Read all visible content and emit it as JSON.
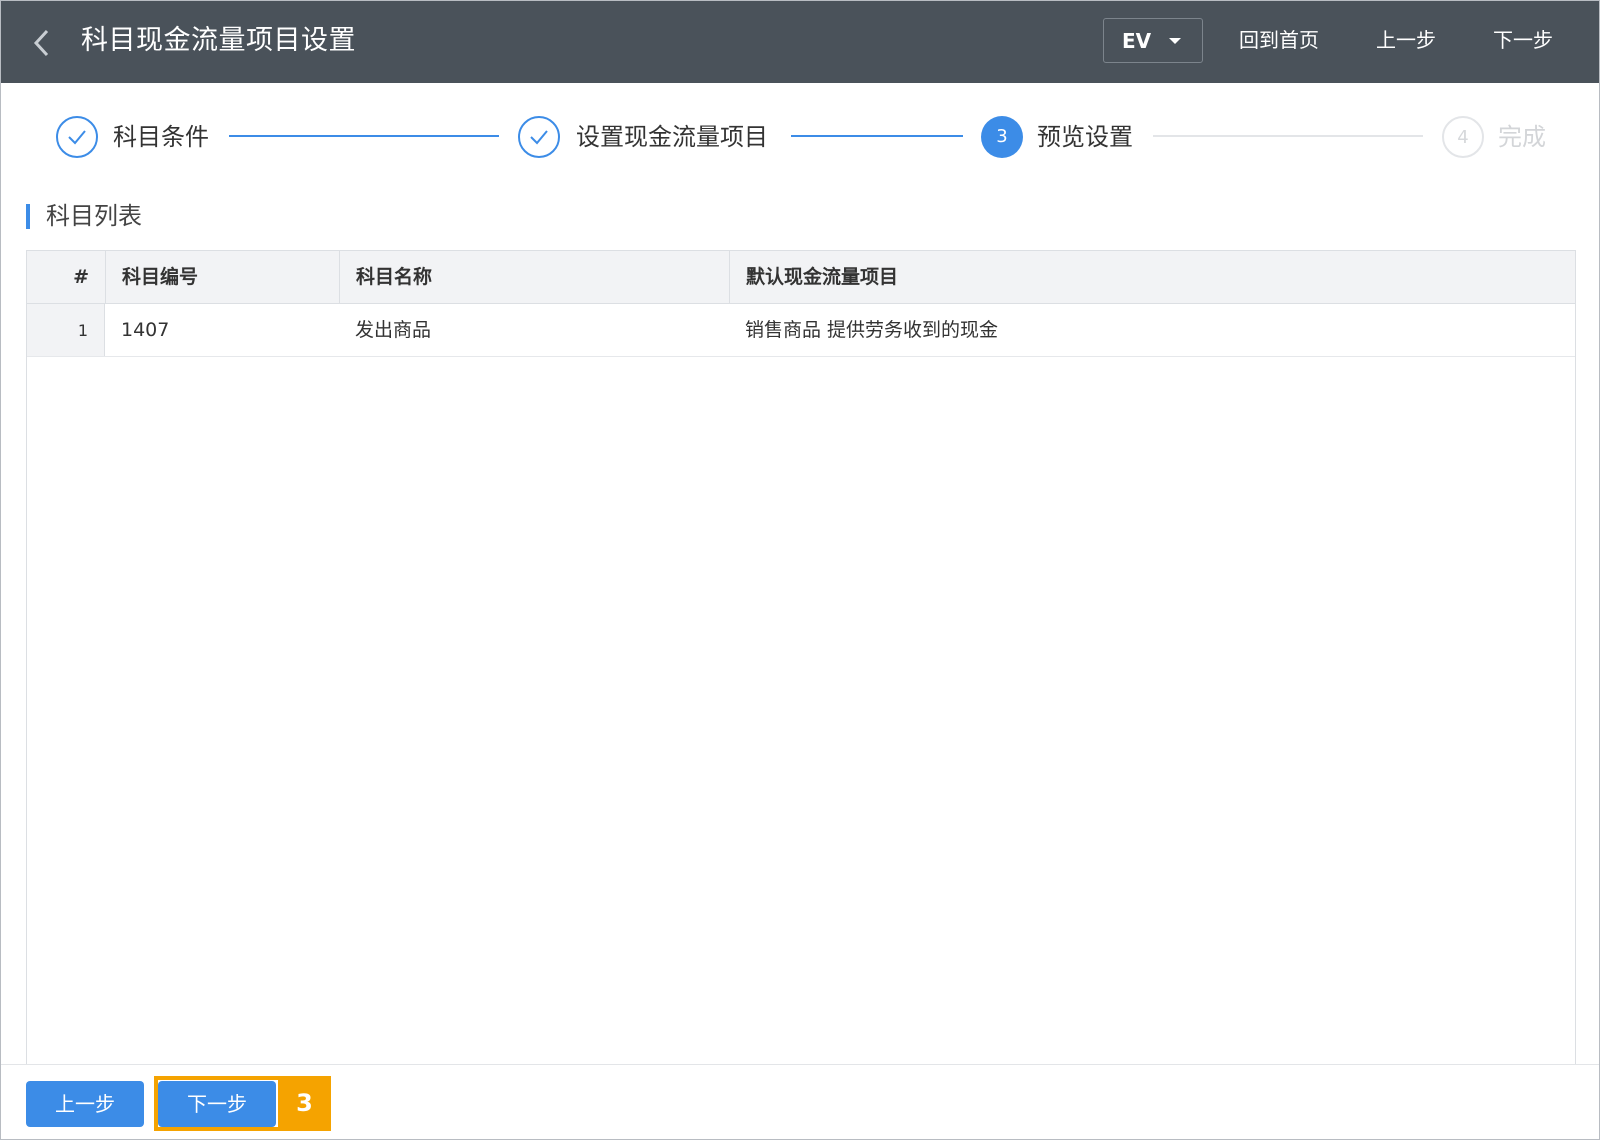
{
  "header": {
    "title": "科目现金流量项目设置",
    "language": "EV",
    "links": [
      "回到首页",
      "上一步",
      "下一步"
    ]
  },
  "steps": [
    {
      "label": "科目条件",
      "status": "done"
    },
    {
      "label": "设置现金流量项目",
      "status": "done"
    },
    {
      "number": "3",
      "label": "预览设置",
      "status": "active"
    },
    {
      "number": "4",
      "label": "完成",
      "status": "pending"
    }
  ],
  "section": {
    "title": "科目列表"
  },
  "table": {
    "headers": [
      "#",
      "科目编号",
      "科目名称",
      "默认现金流量项目"
    ],
    "rows": [
      [
        "1",
        "1407",
        "发出商品",
        "销售商品 提供劳务收到的现金"
      ]
    ]
  },
  "footer": {
    "prev_label": "上一步",
    "next_label": "下一步",
    "annotation": "3"
  },
  "colors": {
    "header_bg": "#4a525a",
    "accent": "#3c8ce7",
    "highlight": "#f5a300"
  },
  "icons": {
    "back": "chevron-left-icon",
    "dropdown": "caret-down-icon",
    "step_done": "check-icon"
  }
}
